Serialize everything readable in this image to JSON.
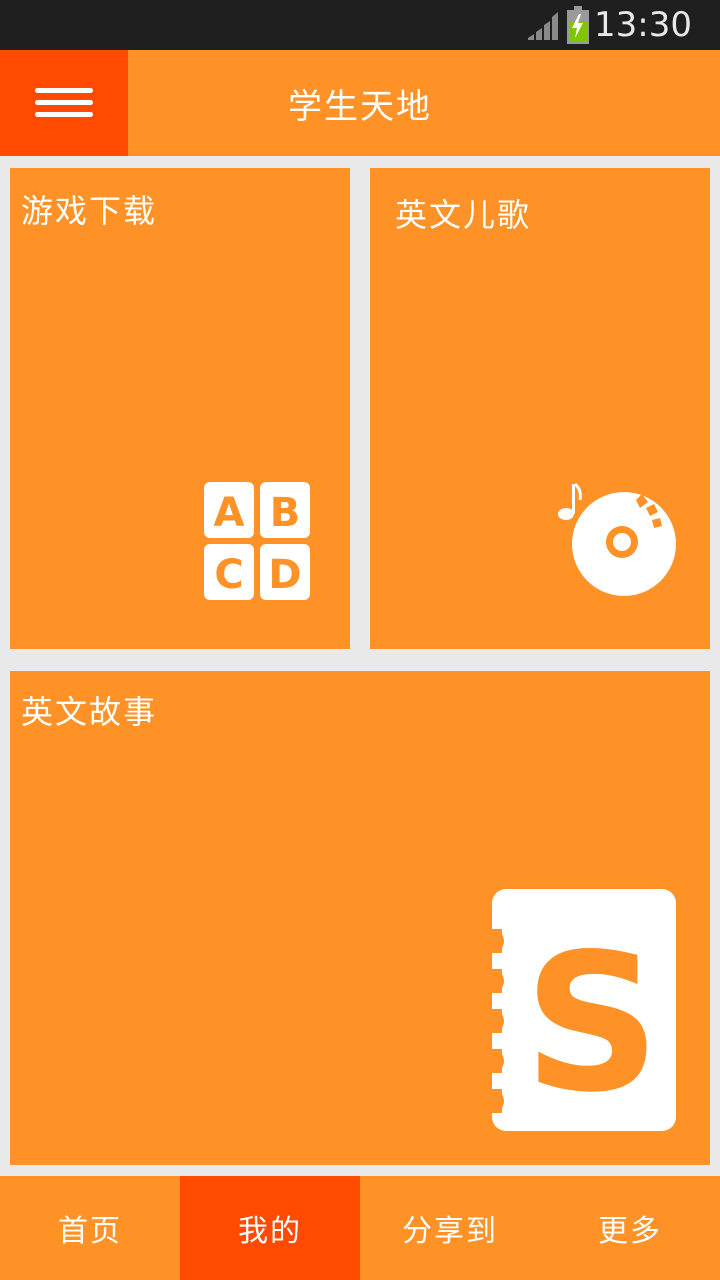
{
  "status_bar": {
    "time": "13:30"
  },
  "app_bar": {
    "title": "学生天地"
  },
  "tiles": {
    "games": {
      "label": "游戏下载",
      "letters": [
        "A",
        "B",
        "C",
        "D"
      ]
    },
    "songs": {
      "label": "英文儿歌"
    },
    "stories": {
      "label": "英文故事",
      "icon_letter": "S"
    }
  },
  "bottom_nav": {
    "items": [
      {
        "label": "首页"
      },
      {
        "label": "我的"
      },
      {
        "label": "分享到"
      },
      {
        "label": "更多"
      }
    ],
    "active_index": 1
  },
  "colors": {
    "primary": "#fe9226",
    "accent": "#ff4a00",
    "background": "#e9e9e9",
    "status_bar": "#1f1f1f"
  }
}
